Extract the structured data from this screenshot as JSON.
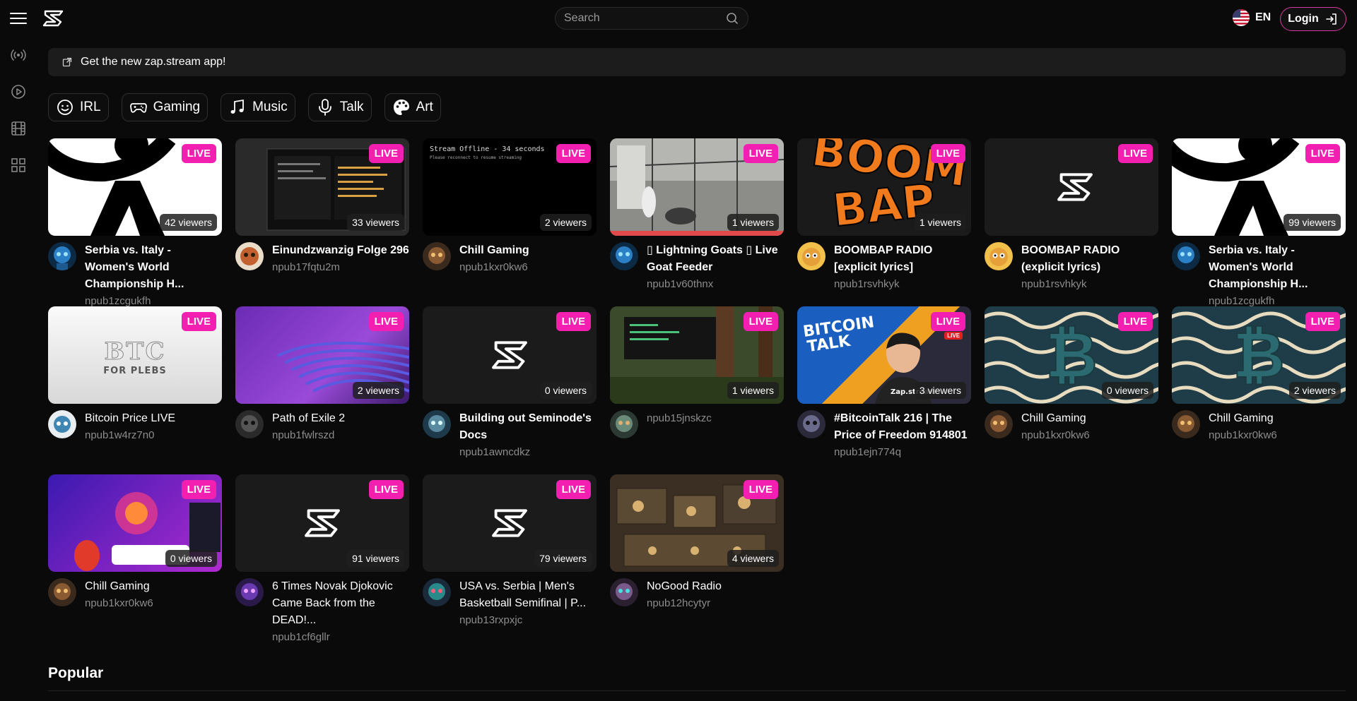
{
  "header": {
    "search_placeholder": "Search",
    "language": "EN",
    "login_label": "Login"
  },
  "banner": {
    "text": "Get the new zap.stream app!"
  },
  "categories": [
    {
      "label": "IRL",
      "icon": "smile-icon"
    },
    {
      "label": "Gaming",
      "icon": "gamepad-icon"
    },
    {
      "label": "Music",
      "icon": "music-note-icon"
    },
    {
      "label": "Talk",
      "icon": "microphone-icon"
    },
    {
      "label": "Art",
      "icon": "palette-icon"
    }
  ],
  "live_badge": "LIVE",
  "streams": [
    {
      "title": "Serbia vs. Italy - Women's World Championship H...",
      "author": "npub1zcgukfh",
      "viewers": "42 viewers"
    },
    {
      "title": "Einundzwanzig Folge 296",
      "author": "npub17fqtu2m",
      "viewers": "33 viewers"
    },
    {
      "title": "Chill Gaming",
      "author": "npub1kxr0kw6",
      "viewers": "2 viewers"
    },
    {
      "title": "▯ Lightning Goats ▯ Live Goat Feeder",
      "author": "npub1v60thnx",
      "viewers": "1 viewers"
    },
    {
      "title": "BOOMBAP RADIO [explicit lyrics]",
      "author": "npub1rsvhkyk",
      "viewers": "1 viewers"
    },
    {
      "title": "BOOMBAP RADIO (explicit lyrics)",
      "author": "npub1rsvhkyk",
      "viewers": ""
    },
    {
      "title": "Serbia vs. Italy - Women's World Championship H...",
      "author": "npub1zcgukfh",
      "viewers": "99 viewers"
    },
    {
      "title": "Bitcoin Price LIVE",
      "author": "npub1w4rz7n0",
      "viewers": ""
    },
    {
      "title": "Path of Exile 2",
      "author": "npub1fwlrszd",
      "viewers": "2 viewers"
    },
    {
      "title": "Building out Seminode's Docs",
      "author": "npub1awncdkz",
      "viewers": "0 viewers"
    },
    {
      "title": "",
      "author": "npub15jnskzc",
      "viewers": "1 viewers"
    },
    {
      "title": "#BitcoinTalk 216 | The Price of Freedom 914801",
      "author": "npub1ejn774q",
      "viewers": "3 viewers"
    },
    {
      "title": "Chill Gaming",
      "author": "npub1kxr0kw6",
      "viewers": "0 viewers"
    },
    {
      "title": "Chill Gaming",
      "author": "npub1kxr0kw6",
      "viewers": "2 viewers"
    },
    {
      "title": "Chill Gaming",
      "author": "npub1kxr0kw6",
      "viewers": "0 viewers"
    },
    {
      "title": "6 Times Novak Djokovic Came Back from the DEAD!...",
      "author": "npub1cf6gllr",
      "viewers": "91 viewers"
    },
    {
      "title": "USA vs. Serbia | Men's Basketball Semifinal | P...",
      "author": "npub13rxpxjc",
      "viewers": "79 viewers"
    },
    {
      "title": "NoGood Radio",
      "author": "npub12hcytyr",
      "viewers": "4 viewers"
    }
  ],
  "thumb_text": {
    "offline_title": "Stream Offline - 34 seconds",
    "offline_sub": "Please reconnect to resume streaming",
    "btc_big": "BTC",
    "btc_small": "FOR PLEBS",
    "boom_line1": "BOOM",
    "boom_line2": "BAP",
    "bitcoin_talk_1": "BITCOIN",
    "bitcoin_talk_2": "TALK",
    "zap_stream": "Zap.stream",
    "live_tag": "LIVE"
  },
  "popular": {
    "title": "Popular"
  },
  "colors": {
    "accent": "#f21fb0",
    "login_border": "#d63aa0",
    "background": "#0a0a0a"
  }
}
